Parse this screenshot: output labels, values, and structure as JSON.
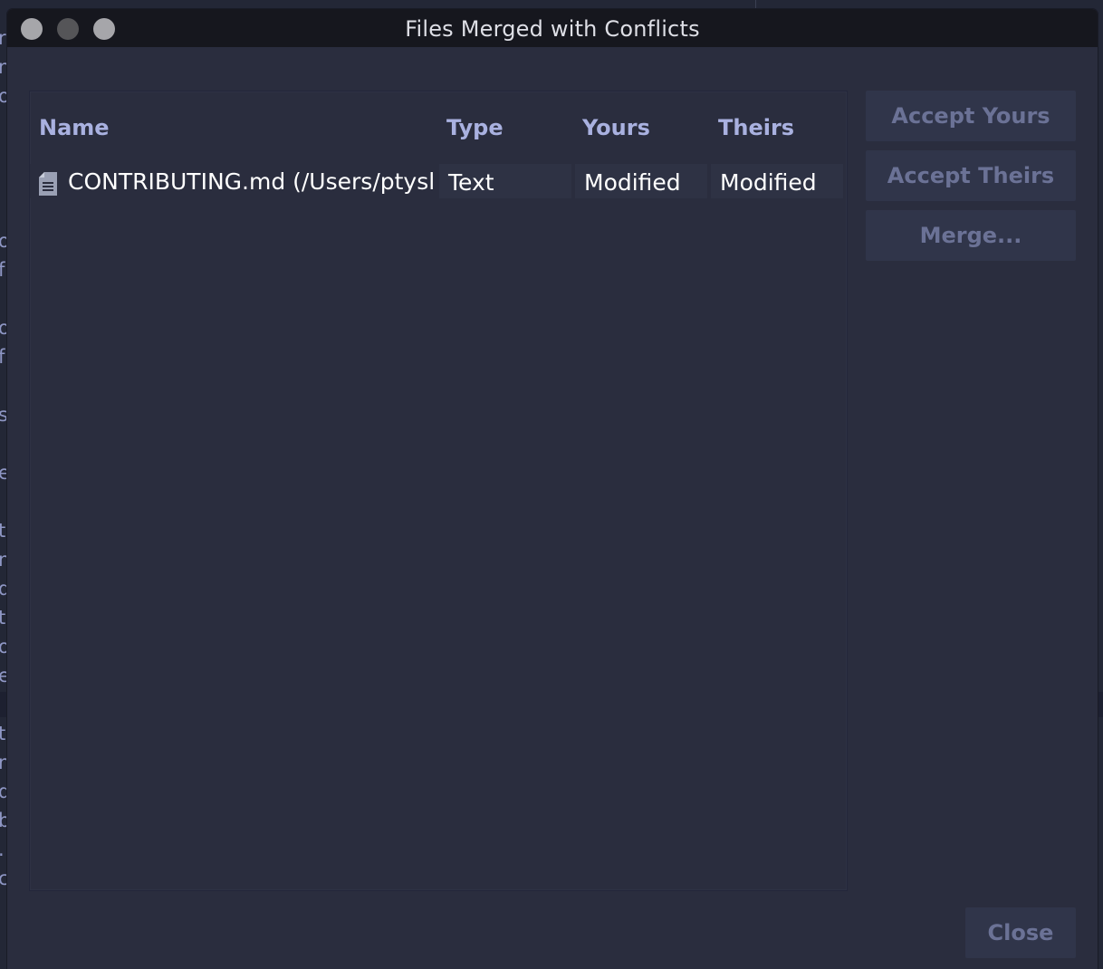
{
  "window": {
    "title": "Files Merged with Conflicts"
  },
  "background": {
    "glyphs": [
      "r",
      "n",
      "o",
      "o",
      "f",
      "o",
      "f",
      "s",
      "e",
      "t",
      "n",
      "d",
      "t",
      "o",
      "e",
      "t",
      "n",
      "d",
      "b",
      ".",
      "c"
    ]
  },
  "table": {
    "columns": {
      "name": "Name",
      "type": "Type",
      "yours": "Yours",
      "theirs": "Theirs"
    },
    "rows": [
      {
        "icon": "document-icon",
        "name": "CONTRIBUTING.md (/Users/ptysl",
        "type": "Text",
        "yours": "Modified",
        "theirs": "Modified"
      }
    ]
  },
  "actions": {
    "accept_yours": "Accept Yours",
    "accept_theirs": "Accept Theirs",
    "merge": "Merge...",
    "close": "Close"
  },
  "colors": {
    "window_bg": "#2a2d3e",
    "titlebar_bg": "#16171e",
    "header_text": "#a9b1e0",
    "button_bg": "#30354a",
    "button_text_disabled": "#6b7296"
  }
}
